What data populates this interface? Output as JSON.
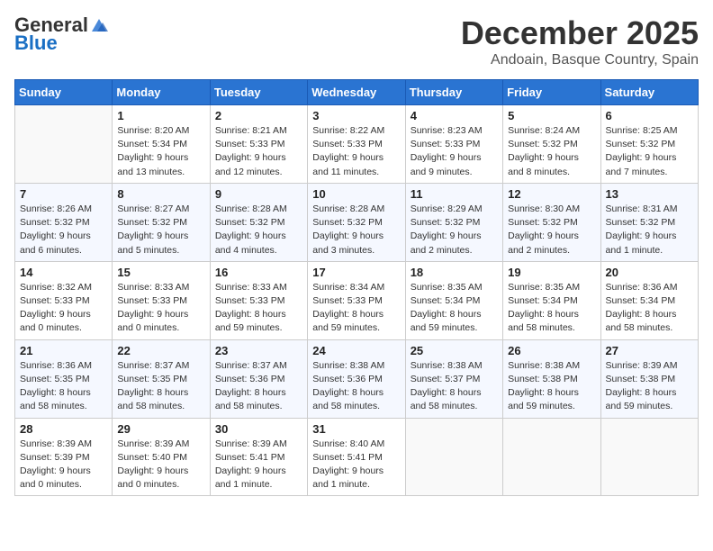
{
  "header": {
    "logo_general": "General",
    "logo_blue": "Blue",
    "month_title": "December 2025",
    "location": "Andoain, Basque Country, Spain"
  },
  "days_of_week": [
    "Sunday",
    "Monday",
    "Tuesday",
    "Wednesday",
    "Thursday",
    "Friday",
    "Saturday"
  ],
  "weeks": [
    [
      {
        "day": "",
        "info": ""
      },
      {
        "day": "1",
        "info": "Sunrise: 8:20 AM\nSunset: 5:34 PM\nDaylight: 9 hours\nand 13 minutes."
      },
      {
        "day": "2",
        "info": "Sunrise: 8:21 AM\nSunset: 5:33 PM\nDaylight: 9 hours\nand 12 minutes."
      },
      {
        "day": "3",
        "info": "Sunrise: 8:22 AM\nSunset: 5:33 PM\nDaylight: 9 hours\nand 11 minutes."
      },
      {
        "day": "4",
        "info": "Sunrise: 8:23 AM\nSunset: 5:33 PM\nDaylight: 9 hours\nand 9 minutes."
      },
      {
        "day": "5",
        "info": "Sunrise: 8:24 AM\nSunset: 5:32 PM\nDaylight: 9 hours\nand 8 minutes."
      },
      {
        "day": "6",
        "info": "Sunrise: 8:25 AM\nSunset: 5:32 PM\nDaylight: 9 hours\nand 7 minutes."
      }
    ],
    [
      {
        "day": "7",
        "info": "Sunrise: 8:26 AM\nSunset: 5:32 PM\nDaylight: 9 hours\nand 6 minutes."
      },
      {
        "day": "8",
        "info": "Sunrise: 8:27 AM\nSunset: 5:32 PM\nDaylight: 9 hours\nand 5 minutes."
      },
      {
        "day": "9",
        "info": "Sunrise: 8:28 AM\nSunset: 5:32 PM\nDaylight: 9 hours\nand 4 minutes."
      },
      {
        "day": "10",
        "info": "Sunrise: 8:28 AM\nSunset: 5:32 PM\nDaylight: 9 hours\nand 3 minutes."
      },
      {
        "day": "11",
        "info": "Sunrise: 8:29 AM\nSunset: 5:32 PM\nDaylight: 9 hours\nand 2 minutes."
      },
      {
        "day": "12",
        "info": "Sunrise: 8:30 AM\nSunset: 5:32 PM\nDaylight: 9 hours\nand 2 minutes."
      },
      {
        "day": "13",
        "info": "Sunrise: 8:31 AM\nSunset: 5:32 PM\nDaylight: 9 hours\nand 1 minute."
      }
    ],
    [
      {
        "day": "14",
        "info": "Sunrise: 8:32 AM\nSunset: 5:33 PM\nDaylight: 9 hours\nand 0 minutes."
      },
      {
        "day": "15",
        "info": "Sunrise: 8:33 AM\nSunset: 5:33 PM\nDaylight: 9 hours\nand 0 minutes."
      },
      {
        "day": "16",
        "info": "Sunrise: 8:33 AM\nSunset: 5:33 PM\nDaylight: 8 hours\nand 59 minutes."
      },
      {
        "day": "17",
        "info": "Sunrise: 8:34 AM\nSunset: 5:33 PM\nDaylight: 8 hours\nand 59 minutes."
      },
      {
        "day": "18",
        "info": "Sunrise: 8:35 AM\nSunset: 5:34 PM\nDaylight: 8 hours\nand 59 minutes."
      },
      {
        "day": "19",
        "info": "Sunrise: 8:35 AM\nSunset: 5:34 PM\nDaylight: 8 hours\nand 58 minutes."
      },
      {
        "day": "20",
        "info": "Sunrise: 8:36 AM\nSunset: 5:34 PM\nDaylight: 8 hours\nand 58 minutes."
      }
    ],
    [
      {
        "day": "21",
        "info": "Sunrise: 8:36 AM\nSunset: 5:35 PM\nDaylight: 8 hours\nand 58 minutes."
      },
      {
        "day": "22",
        "info": "Sunrise: 8:37 AM\nSunset: 5:35 PM\nDaylight: 8 hours\nand 58 minutes."
      },
      {
        "day": "23",
        "info": "Sunrise: 8:37 AM\nSunset: 5:36 PM\nDaylight: 8 hours\nand 58 minutes."
      },
      {
        "day": "24",
        "info": "Sunrise: 8:38 AM\nSunset: 5:36 PM\nDaylight: 8 hours\nand 58 minutes."
      },
      {
        "day": "25",
        "info": "Sunrise: 8:38 AM\nSunset: 5:37 PM\nDaylight: 8 hours\nand 58 minutes."
      },
      {
        "day": "26",
        "info": "Sunrise: 8:38 AM\nSunset: 5:38 PM\nDaylight: 8 hours\nand 59 minutes."
      },
      {
        "day": "27",
        "info": "Sunrise: 8:39 AM\nSunset: 5:38 PM\nDaylight: 8 hours\nand 59 minutes."
      }
    ],
    [
      {
        "day": "28",
        "info": "Sunrise: 8:39 AM\nSunset: 5:39 PM\nDaylight: 9 hours\nand 0 minutes."
      },
      {
        "day": "29",
        "info": "Sunrise: 8:39 AM\nSunset: 5:40 PM\nDaylight: 9 hours\nand 0 minutes."
      },
      {
        "day": "30",
        "info": "Sunrise: 8:39 AM\nSunset: 5:41 PM\nDaylight: 9 hours\nand 1 minute."
      },
      {
        "day": "31",
        "info": "Sunrise: 8:40 AM\nSunset: 5:41 PM\nDaylight: 9 hours\nand 1 minute."
      },
      {
        "day": "",
        "info": ""
      },
      {
        "day": "",
        "info": ""
      },
      {
        "day": "",
        "info": ""
      }
    ]
  ]
}
